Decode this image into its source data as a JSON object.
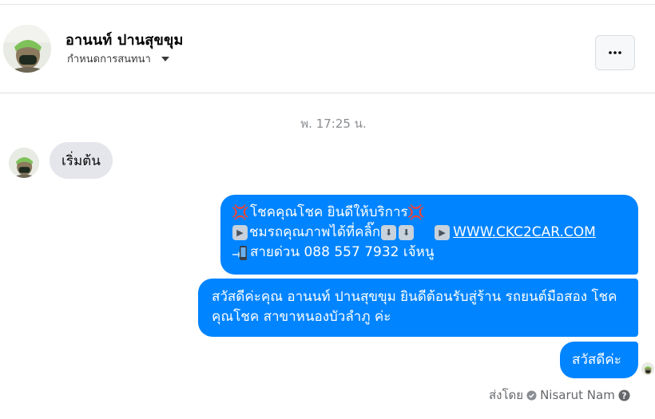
{
  "contact": {
    "name": "อานนท์ ปานสุขขุม",
    "nickname_label": "กำหนดการสนทนา"
  },
  "header": {
    "more_label": "•••"
  },
  "conversation": {
    "timestamp": "พ. 17:25 น.",
    "incoming": [
      {
        "text": "เริ่มต้น"
      }
    ],
    "outgoing": [
      {
        "line1": "โชคคุณโชค ยินดีให้บริการ",
        "line2": "ชมรถคุณภาพได้ที่คลิ๊ก",
        "link": "WWW.CKC2CAR.COM",
        "line3": " สายด่วน 088 557 7932 เจ้หนู"
      },
      {
        "text": "สวัสดีค่ะคุณ อานนท์ ปานสุขขุม ยินดีต้อนรับสู่ร้าน รถยนต์มือสอง โชคคุณโชค สาขาหนองบัวลำภู ค่ะ"
      },
      {
        "text": "สวัสดีค่ะ"
      }
    ]
  },
  "footer": {
    "sent_by_label": "ส่งโดย",
    "sender_name": "Nisarut Nam"
  },
  "icons": {
    "anger": "anger-symbol-icon",
    "play": "play-button-icon",
    "down": "down-arrow-icon",
    "phone": "mobile-phone-arrow-icon",
    "verified": "check-circle-icon",
    "help": "question-circle-icon",
    "caret": "caret-down-icon"
  },
  "colors": {
    "bubble_out": "#0084ff",
    "bubble_in": "#e4e6eb",
    "secondary_text": "#65676b"
  }
}
